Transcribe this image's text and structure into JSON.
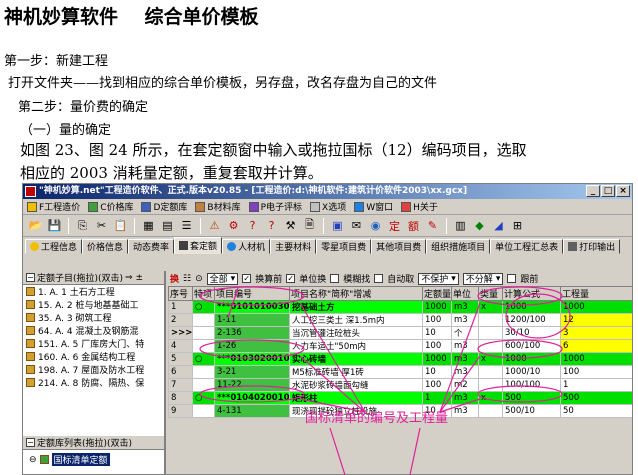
{
  "doc": {
    "title": "神机妙算软件    综合单价模板",
    "step1": "第一步：新建工程",
    "step1_detail": "打开文件夹——找到相应的综合单价模板，另存盘，改名存盘为自己的文件",
    "step2": "第二步：量价费的确定",
    "sub1": "（一）量的确定",
    "para1": "如图 23、图 24 所示，在套定额窗中输入或拖拉国标（12）编码项目，选取",
    "para2": "相应的 2003 消耗量定额，重复套取并计算。"
  },
  "app": {
    "title": "\"神机妙算.net\"工程造价软件、正式.版本v20.85 - [工程造价:d:\\神机软件:建筑计价软件2003\\xx.gcx]",
    "menu": [
      "F工程造价",
      "C价格库",
      "D定额库",
      "B材料库",
      "P电子评标",
      "X选项",
      "W窗口",
      "H关于"
    ],
    "toolbar_icons": [
      "open-icon",
      "save-icon",
      "copy-icon",
      "cut-icon",
      "paste-icon",
      "table-icon",
      "grid-icon",
      "list-icon",
      "print-icon",
      "settings-icon",
      "help-icon",
      "calc-icon",
      "tool-icon",
      "file-icon",
      "book-icon",
      "mail-icon",
      "globe-icon",
      "stamp-icon",
      "edit-icon",
      "pin-icon",
      "doc-icon",
      "power-icon",
      "chart-icon",
      "exit-icon"
    ],
    "tabs": [
      "工程信息",
      "价格信息",
      "动态费率",
      "套定额",
      "人材机",
      "主要材料",
      "零星项目费",
      "其他项目费",
      "组织措施项目",
      "单位工程汇总表",
      "打印输出"
    ],
    "active_tab": "套定额"
  },
  "left": {
    "header": "定额子目(拖拉)(双击)",
    "tree": [
      "1. A. 1  土石方工程",
      "15. A. 2  桩与地基基础工",
      "35. A. 3  砌筑工程",
      "64. A. 4  混凝土及钢筋混",
      "151. A. 5  厂库房大门、特",
      "160. A. 6  金属结构工程",
      "198. A. 7  屋面及防水工程",
      "214. A. 8  防腐、隔热、保"
    ],
    "lib_header": "定额库列表(拖拉)(双击)",
    "lib_item": "国标清单定额"
  },
  "grid_toolbar": {
    "combo_all": "全部",
    "chk_convert": "换算前",
    "chk_unit": "单位换",
    "chk_fuzzy": "模糊找",
    "chk_auto": "自动取",
    "combo_protect": "不保护",
    "combo_split": "不分解",
    "chk_cross": "跟前"
  },
  "grid": {
    "columns": [
      "序号",
      "特项",
      "项目编号",
      "项目名称\"简称\"增减",
      "定额量",
      "单位",
      "类量",
      "计算公式",
      "工程量"
    ],
    "rows": [
      {
        "no": "1",
        "flag": "○",
        "code": "***010101003001",
        "name": "挖基础土方",
        "qty": "1000",
        "unit": "m3",
        "type": "x",
        "formula": "1000",
        "amount": "1000",
        "kind": "grp"
      },
      {
        "no": "2",
        "flag": "",
        "code": "1-11",
        "name": "人工挖三类土 深1.5m内",
        "qty": "100",
        "unit": "m3",
        "type": "",
        "formula": "1200/100",
        "amount": "12",
        "kind": "sub"
      },
      {
        "no": "3",
        "flag": "",
        "code": "2-136",
        "name": "当沉管灌注砼桩头",
        "qty": "10",
        "unit": "个",
        "type": "",
        "formula": "30/10",
        "amount": "3",
        "kind": "sub"
      },
      {
        "no": "4",
        "flag": "",
        "code": "1-26",
        "name": "人力车运土\"50m内",
        "qty": "100",
        "unit": "m3",
        "type": "",
        "formula": "600/100",
        "amount": "6",
        "kind": "sub"
      },
      {
        "no": "5",
        "flag": "○",
        "code": "***010302001001",
        "name": "实心砖墙",
        "qty": "1000",
        "unit": "m3",
        "type": "x",
        "formula": "1000",
        "amount": "1000",
        "kind": "grp"
      },
      {
        "no": "6",
        "flag": "",
        "code": "3-21",
        "name": "M5标准砖墙 厚1砖",
        "qty": "10",
        "unit": "m3",
        "type": "",
        "formula": "1000/10",
        "amount": "100",
        "kind": "sub"
      },
      {
        "no": "7",
        "flag": "",
        "code": "11-22",
        "name": "水泥砂浆砖墙面勾缝",
        "qty": "100",
        "unit": "m2",
        "type": "",
        "formula": "100/100",
        "amount": "1",
        "kind": "sub"
      },
      {
        "no": "8",
        "flag": "○",
        "code": "***010402001001",
        "name": "矩形柱",
        "qty": "1",
        "unit": "m3",
        "type": "x",
        "formula": "500",
        "amount": "500",
        "kind": "grp"
      },
      {
        "no": "9",
        "flag": "",
        "code": "4-131",
        "name": "现浇现拌砼独立柱设施",
        "qty": "10",
        "unit": "m3",
        "type": "",
        "formula": "500/10",
        "amount": "50",
        "kind": "sub"
      }
    ],
    "pointer_row": ">>>"
  },
  "annotation": {
    "label": "国标清单的编号及工程量",
    "color": "#e0209a"
  }
}
